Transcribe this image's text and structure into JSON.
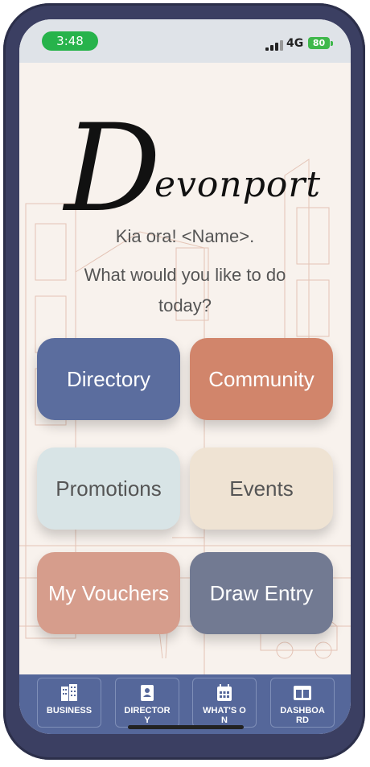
{
  "status_bar": {
    "time": "3:48",
    "network": "4G",
    "battery": "80"
  },
  "logo": {
    "initial": "D",
    "rest": "evonport"
  },
  "greeting": "Kia ora! <Name>.",
  "question": "What would you like to do today?",
  "tiles": [
    {
      "label": "Directory"
    },
    {
      "label": "Community"
    },
    {
      "label": "Promotions"
    },
    {
      "label": "Events"
    },
    {
      "label": "My Vouchers"
    },
    {
      "label": "Draw Entry"
    }
  ],
  "bottom_nav": [
    {
      "label": "BUSINESS",
      "icon": "building-icon"
    },
    {
      "label": "DIRECTORY",
      "icon": "contact-book-icon"
    },
    {
      "label": "WHAT'S ON",
      "icon": "calendar-icon"
    },
    {
      "label": "DASHBOARD",
      "icon": "dashboard-icon"
    }
  ],
  "colors": {
    "directory": "#5b6d9e",
    "community": "#d1856b",
    "promotions": "#d8e4e6",
    "events": "#efe3d3",
    "vouchers": "#d69d8c",
    "draw": "#727a92",
    "nav": "#55679a"
  }
}
